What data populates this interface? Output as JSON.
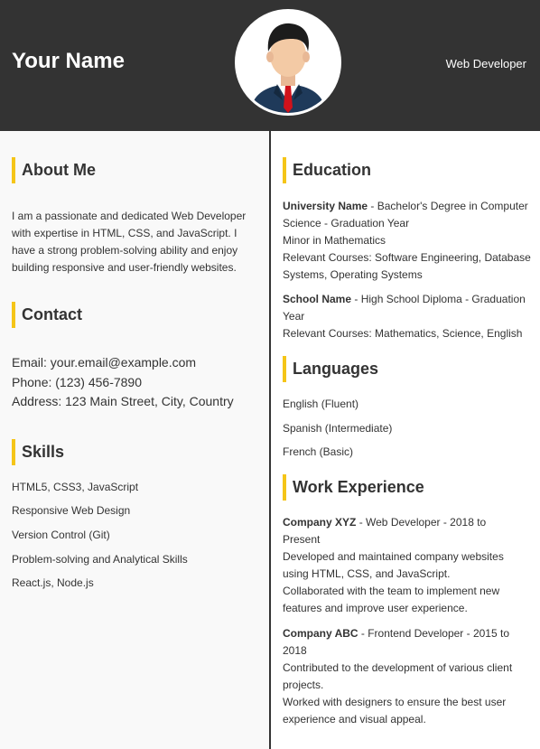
{
  "header": {
    "name": "Your Name",
    "role": "Web Developer"
  },
  "about": {
    "title": "About Me",
    "text": "I am a passionate and dedicated Web Developer with expertise in HTML, CSS, and JavaScript. I have a strong problem-solving ability and enjoy building responsive and user-friendly websites."
  },
  "contact": {
    "title": "Contact",
    "email": "Email: your.email@example.com",
    "phone": "Phone: (123) 456-7890",
    "address": "Address: 123 Main Street, City, Country"
  },
  "skills": {
    "title": "Skills",
    "items": [
      "HTML5, CSS3, JavaScript",
      "Responsive Web Design",
      "Version Control (Git)",
      "Problem-solving and Analytical Skills",
      "React.js, Node.js"
    ]
  },
  "education": {
    "title": "Education",
    "entries": [
      {
        "name": "University Name",
        "desc": " - Bachelor's Degree in Computer Science - Graduation Year",
        "lines": [
          "Minor in Mathematics",
          "Relevant Courses: Software Engineering, Database Systems, Operating Systems"
        ]
      },
      {
        "name": "School Name",
        "desc": " - High School Diploma - Graduation Year",
        "lines": [
          "Relevant Courses: Mathematics, Science, English"
        ]
      }
    ]
  },
  "languages": {
    "title": "Languages",
    "items": [
      "English (Fluent)",
      "Spanish (Intermediate)",
      "French (Basic)"
    ]
  },
  "work": {
    "title": "Work Experience",
    "entries": [
      {
        "name": "Company XYZ",
        "desc": " - Web Developer - 2018 to Present",
        "lines": [
          "Developed and maintained company websites using HTML, CSS, and JavaScript.",
          "Collaborated with the team to implement new features and improve user experience."
        ]
      },
      {
        "name": "Company ABC",
        "desc": " - Frontend Developer - 2015 to 2018",
        "lines": [
          "Contributed to the development of various client projects.",
          "Worked with designers to ensure the best user experience and visual appeal."
        ]
      }
    ]
  }
}
